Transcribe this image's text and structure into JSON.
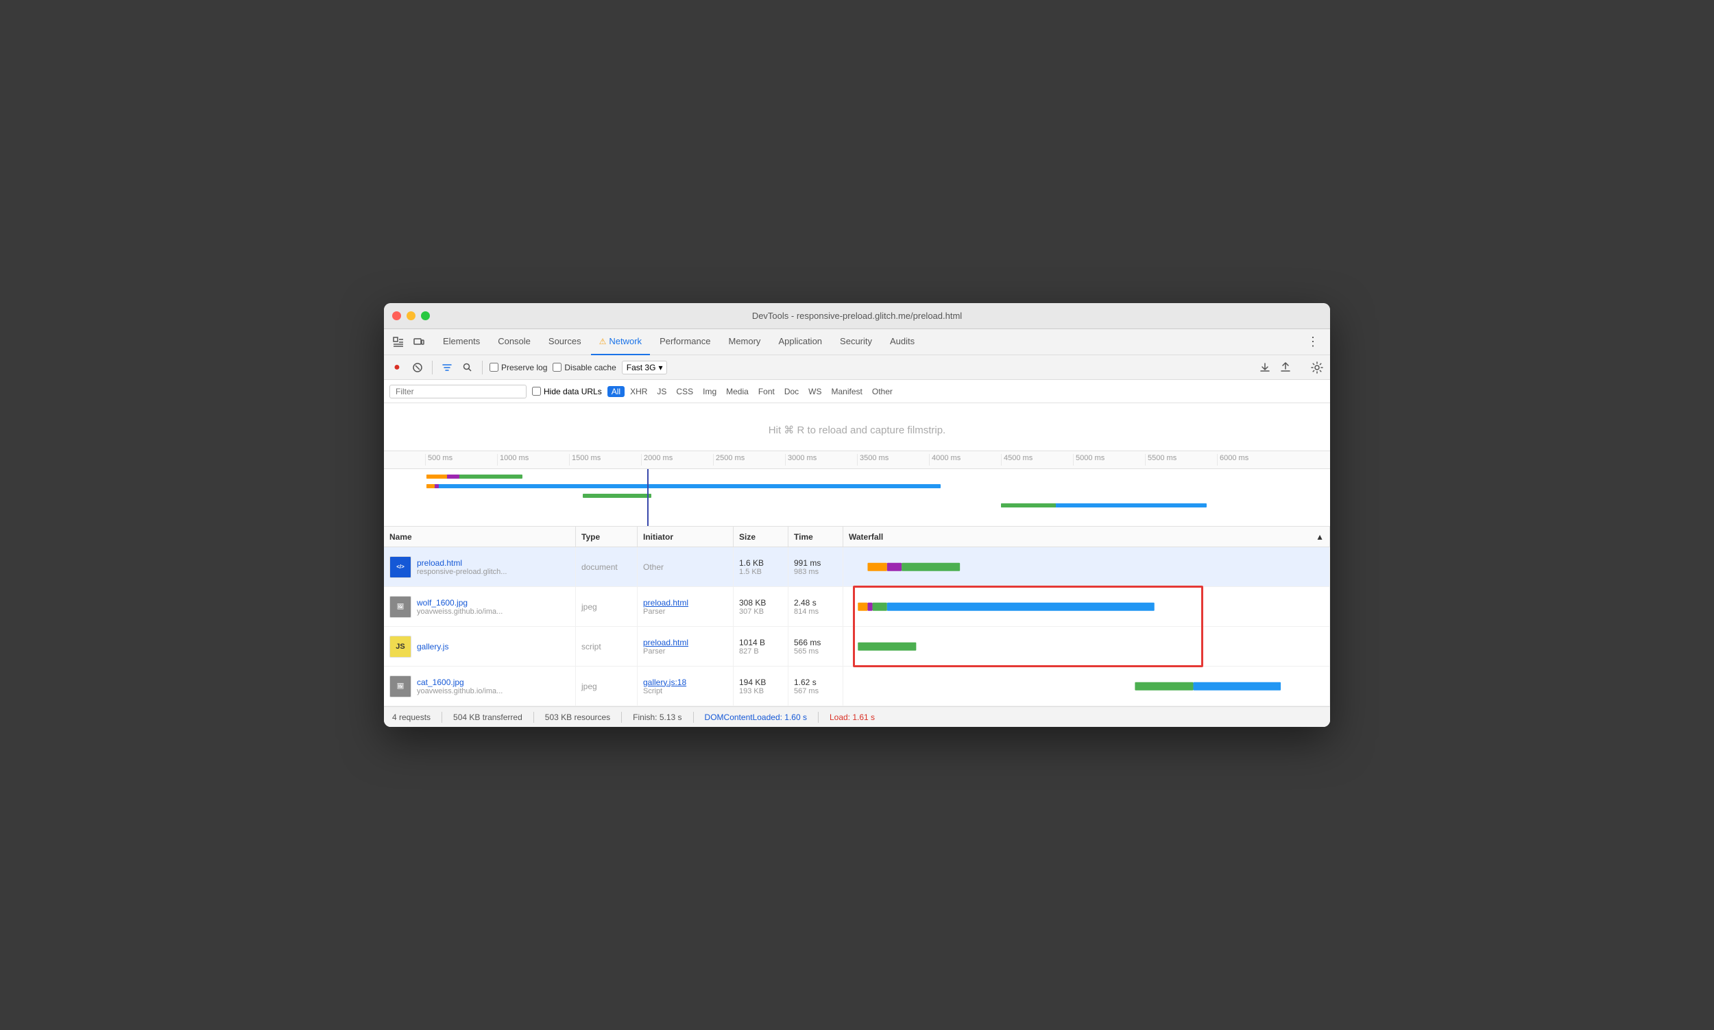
{
  "window": {
    "title": "DevTools - responsive-preload.glitch.me/preload.html"
  },
  "tabs": [
    {
      "label": "Elements",
      "active": false
    },
    {
      "label": "Console",
      "active": false
    },
    {
      "label": "Sources",
      "active": false
    },
    {
      "label": "Network",
      "active": true,
      "warning": true
    },
    {
      "label": "Performance",
      "active": false
    },
    {
      "label": "Memory",
      "active": false
    },
    {
      "label": "Application",
      "active": false
    },
    {
      "label": "Security",
      "active": false
    },
    {
      "label": "Audits",
      "active": false
    }
  ],
  "toolbar": {
    "preserve_log": "Preserve log",
    "disable_cache": "Disable cache",
    "throttle": "Fast 3G"
  },
  "filter": {
    "placeholder": "Filter",
    "hide_data_urls": "Hide data URLs",
    "types": [
      "All",
      "XHR",
      "JS",
      "CSS",
      "Img",
      "Media",
      "Font",
      "Doc",
      "WS",
      "Manifest",
      "Other"
    ]
  },
  "filmstrip": {
    "message": "Hit ⌘ R to reload and capture filmstrip."
  },
  "ruler": {
    "ticks": [
      "500 ms",
      "1000 ms",
      "1500 ms",
      "2000 ms",
      "2500 ms",
      "3000 ms",
      "3500 ms",
      "4000 ms",
      "4500 ms",
      "5000 ms",
      "5500 ms",
      "6000 ms"
    ]
  },
  "table": {
    "headers": [
      "Name",
      "Type",
      "Initiator",
      "Size",
      "Time",
      "Waterfall"
    ],
    "sort_icon": "▲",
    "rows": [
      {
        "name": "preload.html",
        "name_sub": "responsive-preload.glitch...",
        "type": "document",
        "initiator": "Other",
        "initiator_link": false,
        "size": "1.6 KB",
        "size_sub": "1.5 KB",
        "time": "991 ms",
        "time_sub": "983 ms",
        "selected": true,
        "icon_type": "html"
      },
      {
        "name": "wolf_1600.jpg",
        "name_sub": "yoavweiss.github.io/ima...",
        "type": "jpeg",
        "initiator": "preload.html",
        "initiator_sub": "Parser",
        "initiator_link": true,
        "size": "308 KB",
        "size_sub": "307 KB",
        "time": "2.48 s",
        "time_sub": "814 ms",
        "selected": false,
        "icon_type": "jpg",
        "highlighted": true
      },
      {
        "name": "gallery.js",
        "name_sub": "",
        "type": "script",
        "initiator": "preload.html",
        "initiator_sub": "Parser",
        "initiator_link": true,
        "size": "1014 B",
        "size_sub": "827 B",
        "time": "566 ms",
        "time_sub": "565 ms",
        "selected": false,
        "icon_type": "js",
        "highlighted": true
      },
      {
        "name": "cat_1600.jpg",
        "name_sub": "yoavweiss.github.io/ima...",
        "type": "jpeg",
        "initiator": "gallery.js:18",
        "initiator_sub": "Script",
        "initiator_link": true,
        "size": "194 KB",
        "size_sub": "193 KB",
        "time": "1.62 s",
        "time_sub": "567 ms",
        "selected": false,
        "icon_type": "jpg"
      }
    ]
  },
  "status": {
    "requests": "4 requests",
    "transferred": "504 KB transferred",
    "resources": "503 KB resources",
    "finish": "Finish: 5.13 s",
    "dom_content_loaded": "DOMContentLoaded: 1.60 s",
    "load": "Load: 1.61 s"
  }
}
